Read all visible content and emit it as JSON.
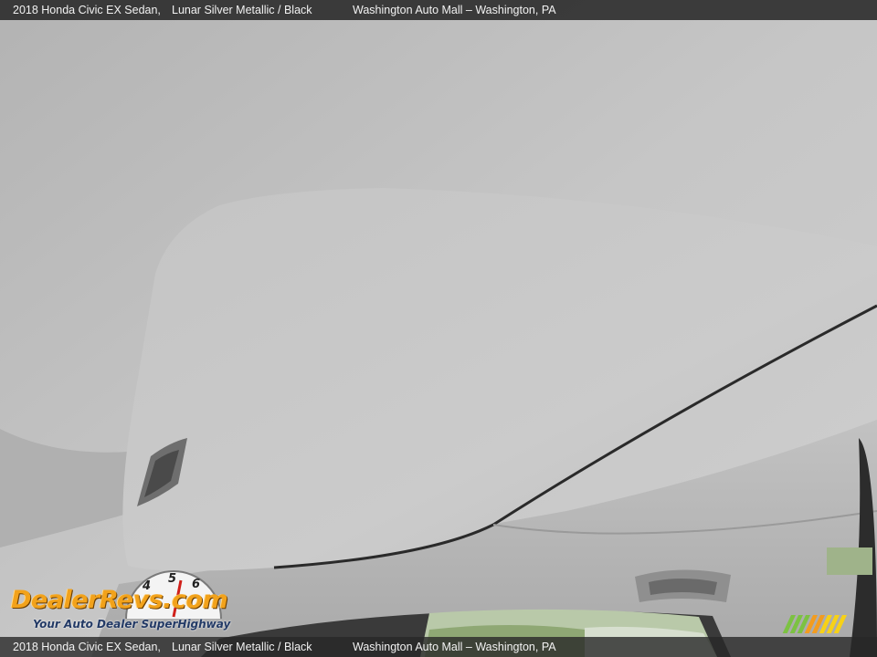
{
  "caption": {
    "vehicle": "2018 Honda Civic EX Sedan,",
    "color": "Lunar Silver Metallic / Black",
    "dealer": "Washington Auto Mall – Washington, PA"
  },
  "watermark": {
    "logo_text": "DealerRevs.com",
    "tagline": "Your Auto Dealer SuperHighway",
    "gauge_digits": [
      "4",
      "5",
      "6"
    ]
  },
  "colors": {
    "headliner": "#c3c3c3",
    "sunroof_shade": "#c9c9c9",
    "caption_bar": "#282828",
    "logo_orange": "#f2a21b",
    "logo_blue": "#233a66",
    "stripe_green": "#7cc242",
    "stripe_orange": "#f39c1f",
    "stripe_yellow": "#f7d117"
  }
}
